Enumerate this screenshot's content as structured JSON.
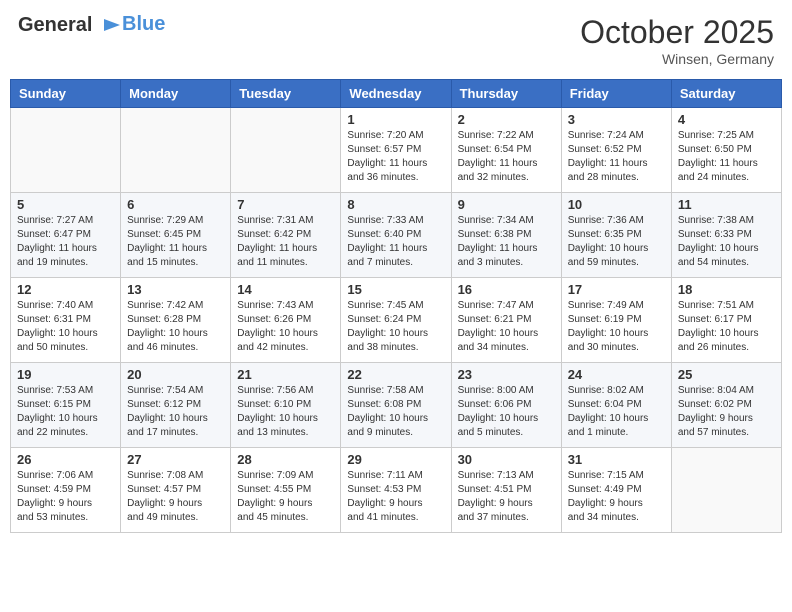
{
  "logo": {
    "line1": "General",
    "line2": "Blue"
  },
  "title": "October 2025",
  "location": "Winsen, Germany",
  "weekdays": [
    "Sunday",
    "Monday",
    "Tuesday",
    "Wednesday",
    "Thursday",
    "Friday",
    "Saturday"
  ],
  "weeks": [
    [
      {
        "day": "",
        "info": ""
      },
      {
        "day": "",
        "info": ""
      },
      {
        "day": "",
        "info": ""
      },
      {
        "day": "1",
        "info": "Sunrise: 7:20 AM\nSunset: 6:57 PM\nDaylight: 11 hours\nand 36 minutes."
      },
      {
        "day": "2",
        "info": "Sunrise: 7:22 AM\nSunset: 6:54 PM\nDaylight: 11 hours\nand 32 minutes."
      },
      {
        "day": "3",
        "info": "Sunrise: 7:24 AM\nSunset: 6:52 PM\nDaylight: 11 hours\nand 28 minutes."
      },
      {
        "day": "4",
        "info": "Sunrise: 7:25 AM\nSunset: 6:50 PM\nDaylight: 11 hours\nand 24 minutes."
      }
    ],
    [
      {
        "day": "5",
        "info": "Sunrise: 7:27 AM\nSunset: 6:47 PM\nDaylight: 11 hours\nand 19 minutes."
      },
      {
        "day": "6",
        "info": "Sunrise: 7:29 AM\nSunset: 6:45 PM\nDaylight: 11 hours\nand 15 minutes."
      },
      {
        "day": "7",
        "info": "Sunrise: 7:31 AM\nSunset: 6:42 PM\nDaylight: 11 hours\nand 11 minutes."
      },
      {
        "day": "8",
        "info": "Sunrise: 7:33 AM\nSunset: 6:40 PM\nDaylight: 11 hours\nand 7 minutes."
      },
      {
        "day": "9",
        "info": "Sunrise: 7:34 AM\nSunset: 6:38 PM\nDaylight: 11 hours\nand 3 minutes."
      },
      {
        "day": "10",
        "info": "Sunrise: 7:36 AM\nSunset: 6:35 PM\nDaylight: 10 hours\nand 59 minutes."
      },
      {
        "day": "11",
        "info": "Sunrise: 7:38 AM\nSunset: 6:33 PM\nDaylight: 10 hours\nand 54 minutes."
      }
    ],
    [
      {
        "day": "12",
        "info": "Sunrise: 7:40 AM\nSunset: 6:31 PM\nDaylight: 10 hours\nand 50 minutes."
      },
      {
        "day": "13",
        "info": "Sunrise: 7:42 AM\nSunset: 6:28 PM\nDaylight: 10 hours\nand 46 minutes."
      },
      {
        "day": "14",
        "info": "Sunrise: 7:43 AM\nSunset: 6:26 PM\nDaylight: 10 hours\nand 42 minutes."
      },
      {
        "day": "15",
        "info": "Sunrise: 7:45 AM\nSunset: 6:24 PM\nDaylight: 10 hours\nand 38 minutes."
      },
      {
        "day": "16",
        "info": "Sunrise: 7:47 AM\nSunset: 6:21 PM\nDaylight: 10 hours\nand 34 minutes."
      },
      {
        "day": "17",
        "info": "Sunrise: 7:49 AM\nSunset: 6:19 PM\nDaylight: 10 hours\nand 30 minutes."
      },
      {
        "day": "18",
        "info": "Sunrise: 7:51 AM\nSunset: 6:17 PM\nDaylight: 10 hours\nand 26 minutes."
      }
    ],
    [
      {
        "day": "19",
        "info": "Sunrise: 7:53 AM\nSunset: 6:15 PM\nDaylight: 10 hours\nand 22 minutes."
      },
      {
        "day": "20",
        "info": "Sunrise: 7:54 AM\nSunset: 6:12 PM\nDaylight: 10 hours\nand 17 minutes."
      },
      {
        "day": "21",
        "info": "Sunrise: 7:56 AM\nSunset: 6:10 PM\nDaylight: 10 hours\nand 13 minutes."
      },
      {
        "day": "22",
        "info": "Sunrise: 7:58 AM\nSunset: 6:08 PM\nDaylight: 10 hours\nand 9 minutes."
      },
      {
        "day": "23",
        "info": "Sunrise: 8:00 AM\nSunset: 6:06 PM\nDaylight: 10 hours\nand 5 minutes."
      },
      {
        "day": "24",
        "info": "Sunrise: 8:02 AM\nSunset: 6:04 PM\nDaylight: 10 hours\nand 1 minute."
      },
      {
        "day": "25",
        "info": "Sunrise: 8:04 AM\nSunset: 6:02 PM\nDaylight: 9 hours\nand 57 minutes."
      }
    ],
    [
      {
        "day": "26",
        "info": "Sunrise: 7:06 AM\nSunset: 4:59 PM\nDaylight: 9 hours\nand 53 minutes."
      },
      {
        "day": "27",
        "info": "Sunrise: 7:08 AM\nSunset: 4:57 PM\nDaylight: 9 hours\nand 49 minutes."
      },
      {
        "day": "28",
        "info": "Sunrise: 7:09 AM\nSunset: 4:55 PM\nDaylight: 9 hours\nand 45 minutes."
      },
      {
        "day": "29",
        "info": "Sunrise: 7:11 AM\nSunset: 4:53 PM\nDaylight: 9 hours\nand 41 minutes."
      },
      {
        "day": "30",
        "info": "Sunrise: 7:13 AM\nSunset: 4:51 PM\nDaylight: 9 hours\nand 37 minutes."
      },
      {
        "day": "31",
        "info": "Sunrise: 7:15 AM\nSunset: 4:49 PM\nDaylight: 9 hours\nand 34 minutes."
      },
      {
        "day": "",
        "info": ""
      }
    ]
  ]
}
